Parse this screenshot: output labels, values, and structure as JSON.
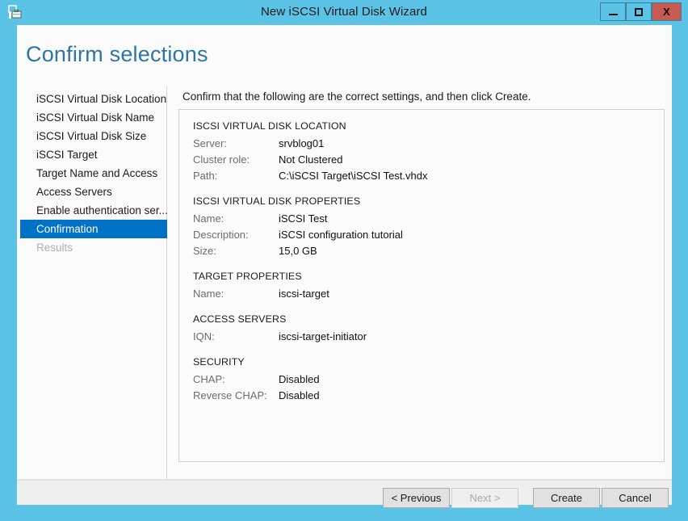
{
  "window": {
    "title": "New iSCSI Virtual Disk Wizard",
    "icon": "iscsi-disk-wizard-icon",
    "controls": {
      "minimize": "minimize-icon",
      "maximize": "maximize-icon",
      "close": "X"
    },
    "frame_color": "#5BC3E5",
    "close_color": "#C75B51"
  },
  "page": {
    "title": "Confirm selections",
    "title_color": "#2E75A3",
    "intro": "Confirm that the following are the correct settings, and then click Create."
  },
  "sidebar": {
    "selected_color": "#0072C6",
    "items": [
      {
        "label": "iSCSI Virtual Disk Location",
        "state": "normal"
      },
      {
        "label": "iSCSI Virtual Disk Name",
        "state": "normal"
      },
      {
        "label": "iSCSI Virtual Disk Size",
        "state": "normal"
      },
      {
        "label": "iSCSI Target",
        "state": "normal"
      },
      {
        "label": "Target Name and Access",
        "state": "normal"
      },
      {
        "label": "Access Servers",
        "state": "normal"
      },
      {
        "label": "Enable authentication ser...",
        "state": "normal"
      },
      {
        "label": "Confirmation",
        "state": "selected"
      },
      {
        "label": "Results",
        "state": "disabled"
      }
    ]
  },
  "summary": {
    "sections": [
      {
        "heading": "ISCSI VIRTUAL DISK LOCATION",
        "rows": [
          {
            "label": "Server:",
            "value": "srvblog01"
          },
          {
            "label": "Cluster role:",
            "value": "Not Clustered"
          },
          {
            "label": "Path:",
            "value": "C:\\iSCSI Target\\iSCSI Test.vhdx"
          }
        ]
      },
      {
        "heading": "ISCSI VIRTUAL DISK PROPERTIES",
        "rows": [
          {
            "label": "Name:",
            "value": "iSCSI Test"
          },
          {
            "label": "Description:",
            "value": "iSCSI configuration tutorial"
          },
          {
            "label": "Size:",
            "value": "15,0 GB"
          }
        ]
      },
      {
        "heading": "TARGET PROPERTIES",
        "rows": [
          {
            "label": "Name:",
            "value": "iscsi-target"
          }
        ]
      },
      {
        "heading": "ACCESS SERVERS",
        "rows": [
          {
            "label": "IQN:",
            "value": "iscsi-target-initiator"
          }
        ]
      },
      {
        "heading": "SECURITY",
        "rows": [
          {
            "label": "CHAP:",
            "value": "Disabled"
          },
          {
            "label": "Reverse CHAP:",
            "value": "Disabled"
          }
        ]
      }
    ]
  },
  "footer": {
    "buttons": [
      {
        "id": "previous",
        "label": "< Previous",
        "state": "enabled"
      },
      {
        "id": "next",
        "label": "Next >",
        "state": "disabled"
      },
      {
        "id": "create",
        "label": "Create",
        "state": "enabled"
      },
      {
        "id": "cancel",
        "label": "Cancel",
        "state": "enabled"
      }
    ]
  }
}
